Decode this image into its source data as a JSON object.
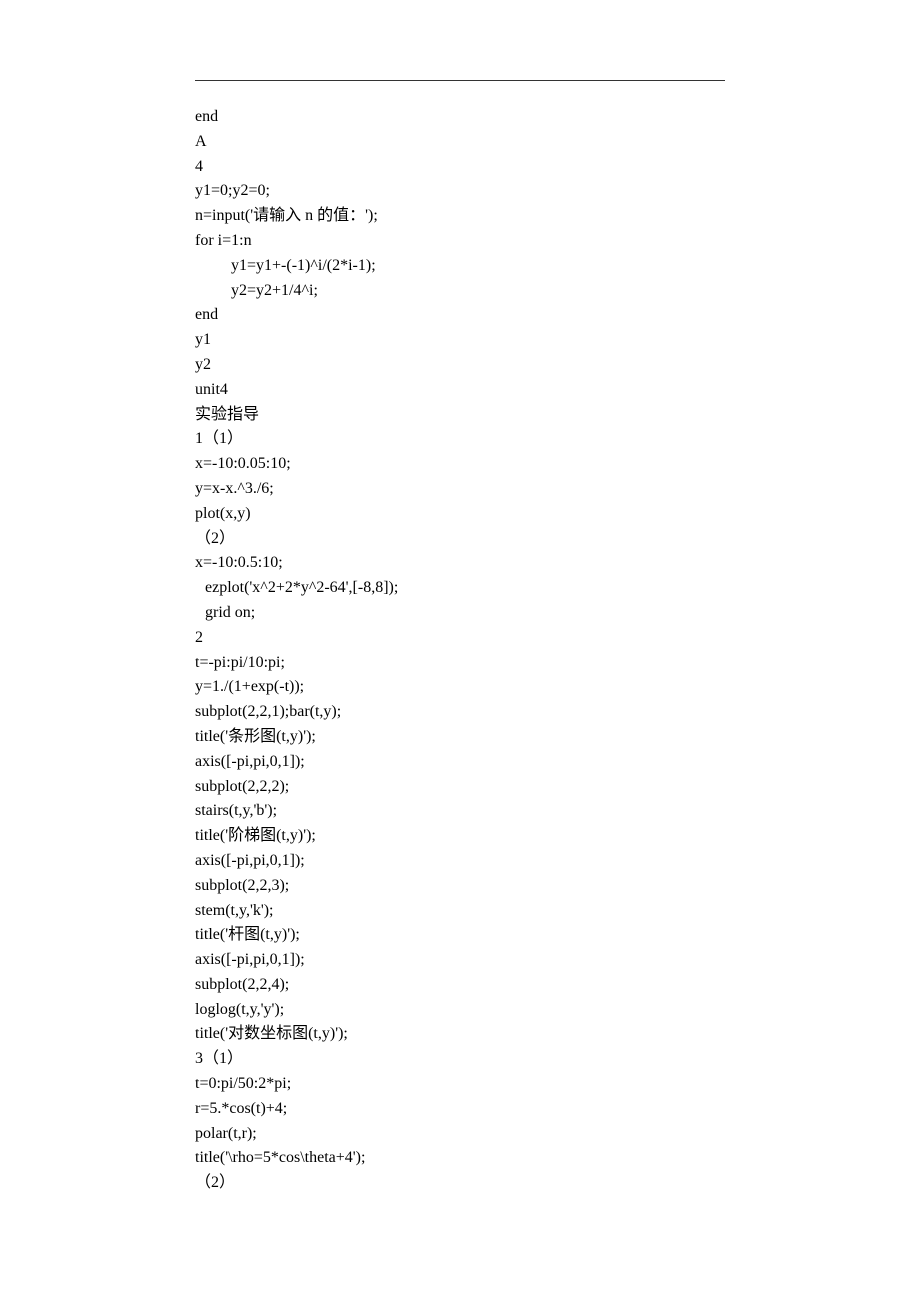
{
  "lines": [
    {
      "text": "end",
      "cls": "code-line"
    },
    {
      "text": "A",
      "cls": "code-line"
    },
    {
      "text": "4",
      "cls": "code-line"
    },
    {
      "text": "y1=0;y2=0;",
      "cls": "code-line"
    },
    {
      "text": "n=input('请输入 n 的值：');",
      "cls": "code-line"
    },
    {
      "text": "for i=1:n",
      "cls": "code-line"
    },
    {
      "text": "y1=y1+-(-1)^i/(2*i-1);",
      "cls": "code-line indent1"
    },
    {
      "text": "y2=y2+1/4^i;",
      "cls": "code-line indent1"
    },
    {
      "text": "end",
      "cls": "code-line"
    },
    {
      "text": "y1",
      "cls": "code-line"
    },
    {
      "text": "y2",
      "cls": "code-line"
    },
    {
      "text": "unit4",
      "cls": "code-line"
    },
    {
      "text": "实验指导",
      "cls": "code-line"
    },
    {
      "text": "1（1）",
      "cls": "code-line"
    },
    {
      "text": "x=-10:0.05:10;",
      "cls": "code-line"
    },
    {
      "text": "y=x-x.^3./6;",
      "cls": "code-line"
    },
    {
      "text": "plot(x,y)",
      "cls": "code-line"
    },
    {
      "text": "（2）",
      "cls": "code-line"
    },
    {
      "text": "x=-10:0.5:10;",
      "cls": "code-line"
    },
    {
      "text": "ezplot('x^2+2*y^2-64',[-8,8]);",
      "cls": "code-line small-indent"
    },
    {
      "text": "grid on;",
      "cls": "code-line small-indent"
    },
    {
      "text": "2",
      "cls": "code-line"
    },
    {
      "text": "t=-pi:pi/10:pi;",
      "cls": "code-line"
    },
    {
      "text": "y=1./(1+exp(-t));",
      "cls": "code-line"
    },
    {
      "text": "subplot(2,2,1);bar(t,y);",
      "cls": "code-line"
    },
    {
      "text": "title('条形图(t,y)');",
      "cls": "code-line"
    },
    {
      "text": "axis([-pi,pi,0,1]);",
      "cls": "code-line"
    },
    {
      "text": "subplot(2,2,2);",
      "cls": "code-line"
    },
    {
      "text": "stairs(t,y,'b');",
      "cls": "code-line"
    },
    {
      "text": "title('阶梯图(t,y)');",
      "cls": "code-line"
    },
    {
      "text": "axis([-pi,pi,0,1]);",
      "cls": "code-line"
    },
    {
      "text": "subplot(2,2,3);",
      "cls": "code-line"
    },
    {
      "text": "stem(t,y,'k');",
      "cls": "code-line"
    },
    {
      "text": "title('杆图(t,y)');",
      "cls": "code-line"
    },
    {
      "text": "axis([-pi,pi,0,1]);",
      "cls": "code-line"
    },
    {
      "text": "subplot(2,2,4);",
      "cls": "code-line"
    },
    {
      "text": "loglog(t,y,'y');",
      "cls": "code-line"
    },
    {
      "text": "title('对数坐标图(t,y)');",
      "cls": "code-line"
    },
    {
      "text": "3（1）",
      "cls": "code-line"
    },
    {
      "text": "t=0:pi/50:2*pi;",
      "cls": "code-line"
    },
    {
      "text": "r=5.*cos(t)+4;",
      "cls": "code-line"
    },
    {
      "text": "polar(t,r);",
      "cls": "code-line"
    },
    {
      "text": "title('\\rho=5*cos\\theta+4');",
      "cls": "code-line"
    },
    {
      "text": "（2）",
      "cls": "code-line"
    }
  ]
}
